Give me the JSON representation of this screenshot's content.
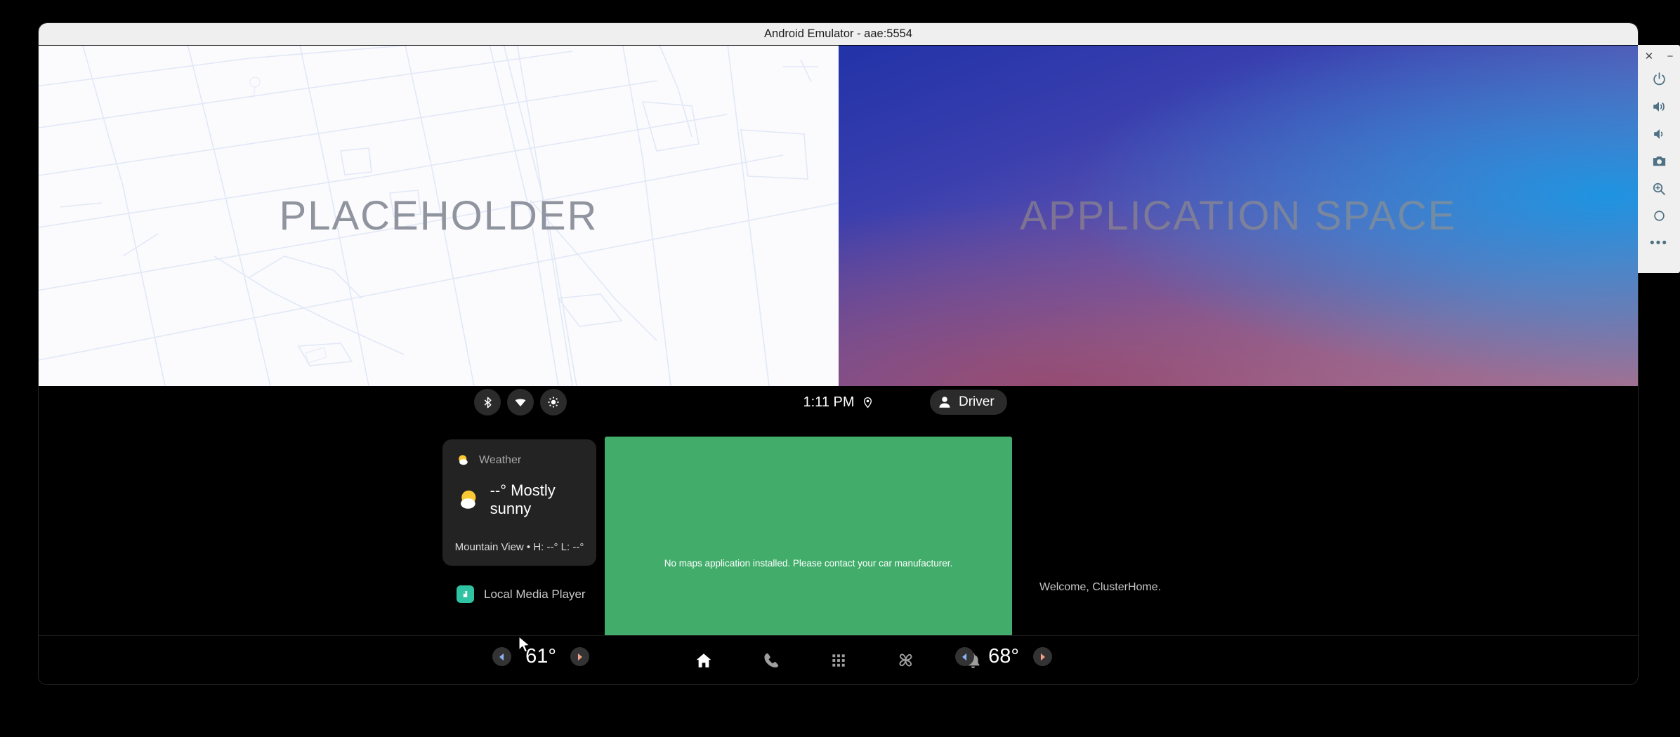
{
  "window": {
    "title": "Android Emulator - aae:5554"
  },
  "top_panes": {
    "placeholder_label": "PLACEHOLDER",
    "appspace_label": "APPLICATION SPACE"
  },
  "status_bar": {
    "quick_icons": [
      {
        "name": "bluetooth-icon",
        "label": "Bluetooth"
      },
      {
        "name": "wifi-icon",
        "label": "Wi-Fi"
      },
      {
        "name": "brightness-icon",
        "label": "Brightness"
      }
    ],
    "clock": "1:11 PM",
    "location_icon": "location-pin-icon",
    "user_pill": {
      "label": "Driver",
      "icon": "person-icon"
    }
  },
  "weather_card": {
    "header": "Weather",
    "condition": "--° Mostly sunny",
    "footer": "Mountain View • H: --° L: --°",
    "icon": "partly-sunny-icon"
  },
  "media": {
    "label": "Local Media Player",
    "icon": "media-app-icon",
    "icon_color": "#30c3a1"
  },
  "maps_panel": {
    "message": "No maps application installed. Please contact your car manufacturer.",
    "background_color": "#42ad6b"
  },
  "cluster": {
    "welcome": "Welcome, ClusterHome."
  },
  "nav_bar": {
    "temp_left": {
      "value": "61°",
      "decrease_label": "Decrease driver temperature",
      "increase_label": "Increase driver temperature"
    },
    "temp_right": {
      "value": "68°",
      "decrease_label": "Decrease passenger temperature",
      "increase_label": "Increase passenger temperature"
    },
    "items": [
      {
        "name": "nav-home",
        "label": "Home",
        "active": true
      },
      {
        "name": "nav-dialer",
        "label": "Phone",
        "active": false
      },
      {
        "name": "nav-apps",
        "label": "All apps",
        "active": false
      },
      {
        "name": "nav-climate",
        "label": "Climate",
        "active": false
      },
      {
        "name": "nav-notifications",
        "label": "Notifications",
        "active": false
      }
    ]
  },
  "emulator_toolbar": {
    "close_label": "✕",
    "minimize_label": "−",
    "buttons": [
      {
        "name": "power-button",
        "label": "Power"
      },
      {
        "name": "volume-up-button",
        "label": "Volume up"
      },
      {
        "name": "volume-down-button",
        "label": "Volume down"
      },
      {
        "name": "screenshot-button",
        "label": "Take screenshot"
      },
      {
        "name": "zoom-button",
        "label": "Zoom"
      },
      {
        "name": "rotate-button",
        "label": "Rotate"
      },
      {
        "name": "more-button",
        "label": "More"
      }
    ]
  },
  "colors": {
    "accent_green": "#42ad6b",
    "chip_bg": "#2b2b2b",
    "card_bg": "#232323",
    "cool_arrow": "#8ab4f8",
    "warm_arrow": "#f2a08b"
  }
}
